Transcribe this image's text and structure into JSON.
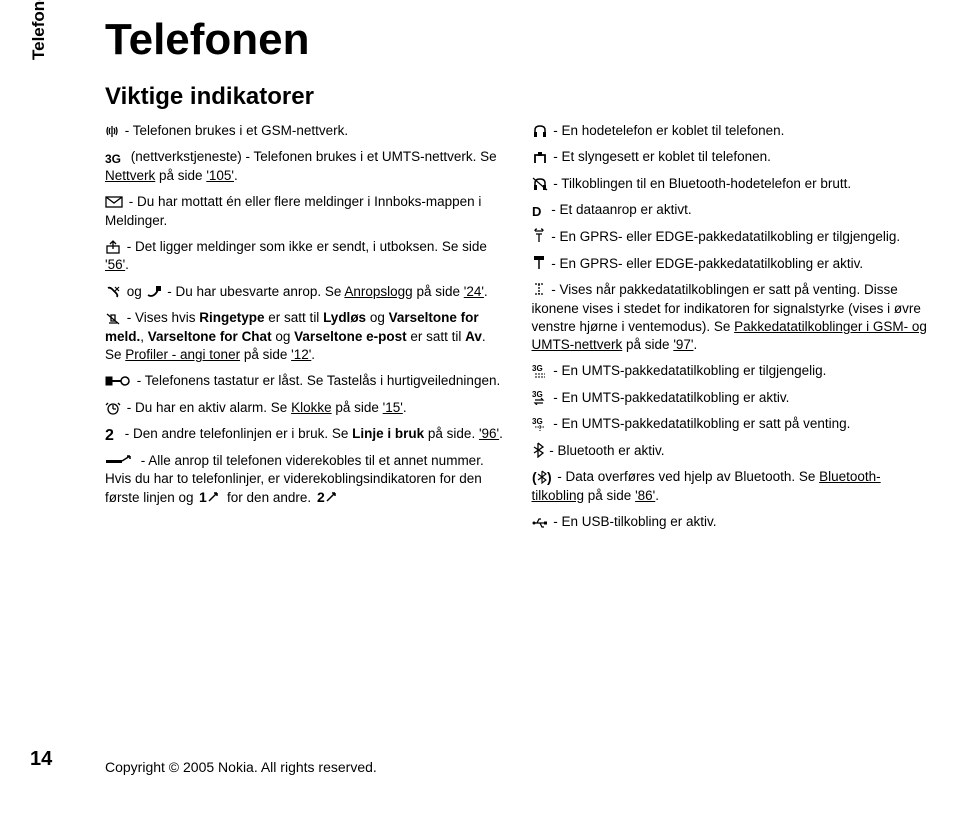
{
  "sideTab": "Telefonen",
  "pageNumber": "14",
  "copyright": "Copyright © 2005 Nokia. All rights reserved.",
  "title": "Telefonen",
  "subtitle": "Viktige indikatorer",
  "col1": {
    "e1_a": " - Telefonen brukes i et GSM-nettverk.",
    "e2_a": " (nettverkstjeneste) - Telefonen brukes i et UMTS-nettverk. Se ",
    "e2_link": "Nettverk",
    "e2_b": " på side ",
    "e2_link2": "'105'",
    "e2_c": ".",
    "e3_a": " - Du har mottatt én eller flere meldinger i Innboks-mappen i Meldinger.",
    "e4_a": " - Det ligger meldinger som ikke er sendt, i utboksen. Se side ",
    "e4_link": "'56'",
    "e4_b": ".",
    "e5_a": " og ",
    "e5_b": " - Du har ubesvarte anrop. Se ",
    "e5_link": "Anropslogg",
    "e5_c": " på side ",
    "e5_link2": "'24'",
    "e5_d": ".",
    "e6_a": " - Vises hvis ",
    "e6_b1": "Ringetype",
    "e6_b": " er satt til ",
    "e6_b2": "Lydløs",
    "e6_c": " og ",
    "e6_b3": "Varseltone for meld.",
    "e6_d": ", ",
    "e6_b4": "Varseltone for Chat",
    "e6_e": " og ",
    "e6_b5": "Varseltone e-post",
    "e6_f": " er satt til ",
    "e6_b6": "Av",
    "e6_g": ". Se ",
    "e6_link": "Profiler - angi toner",
    "e6_h": " på side ",
    "e6_link2": "'12'",
    "e6_i": ".",
    "e7_a": " - Telefonens tastatur er låst. Se Tastelås i hurtigveiledningen.",
    "e8_a": " - Du har en aktiv alarm. Se ",
    "e8_link": "Klokke",
    "e8_b": " på side ",
    "e8_link2": "'15'",
    "e8_c": ".",
    "e9_a": " - Den andre telefonlinjen er i bruk. Se ",
    "e9_b1": "Linje i bruk",
    "e9_b": " på side. ",
    "e9_link": "'96'",
    "e9_c": ".",
    "e10_a": " - Alle anrop til telefonen viderekobles til et annet nummer. Hvis du har to telefonlinjer, er viderekoblingsindikatoren for den første linjen og ",
    "e10_b": " for den andre."
  },
  "col2": {
    "e1": " - En hodetelefon er koblet til telefonen.",
    "e2": " - Et slyngesett er koblet til telefonen.",
    "e3": " - Tilkoblingen til en Bluetooth-hodetelefon er brutt.",
    "e4": " - Et dataanrop er aktivt.",
    "e5": " - En GPRS- eller EDGE-pakkedatatilkobling er tilgjengelig.",
    "e6": " - En GPRS- eller EDGE-pakkedatatilkobling er aktiv.",
    "e7_a": " - Vises når pakkedatatilkoblingen er satt på venting. Disse ikonene vises i stedet for indikatoren for signalstyrke (vises i øvre venstre hjørne i ventemodus). Se ",
    "e7_link": "Pakkedatatilkoblinger i GSM- og UMTS-nettverk",
    "e7_b": " på side ",
    "e7_link2": "'97'",
    "e7_c": ".",
    "e8": " - En UMTS-pakkedatatilkobling er tilgjengelig.",
    "e9": " - En UMTS-pakkedatatilkobling er aktiv.",
    "e10": " - En UMTS-pakkedatatilkobling er satt på venting.",
    "e11": " - Bluetooth er aktiv.",
    "e12_a": " - Data overføres ved hjelp av Bluetooth. Se ",
    "e12_link": "Bluetooth-tilkobling",
    "e12_b": " på side ",
    "e12_link2": "'86'",
    "e12_c": ".",
    "e13": " - En USB-tilkobling er aktiv."
  }
}
